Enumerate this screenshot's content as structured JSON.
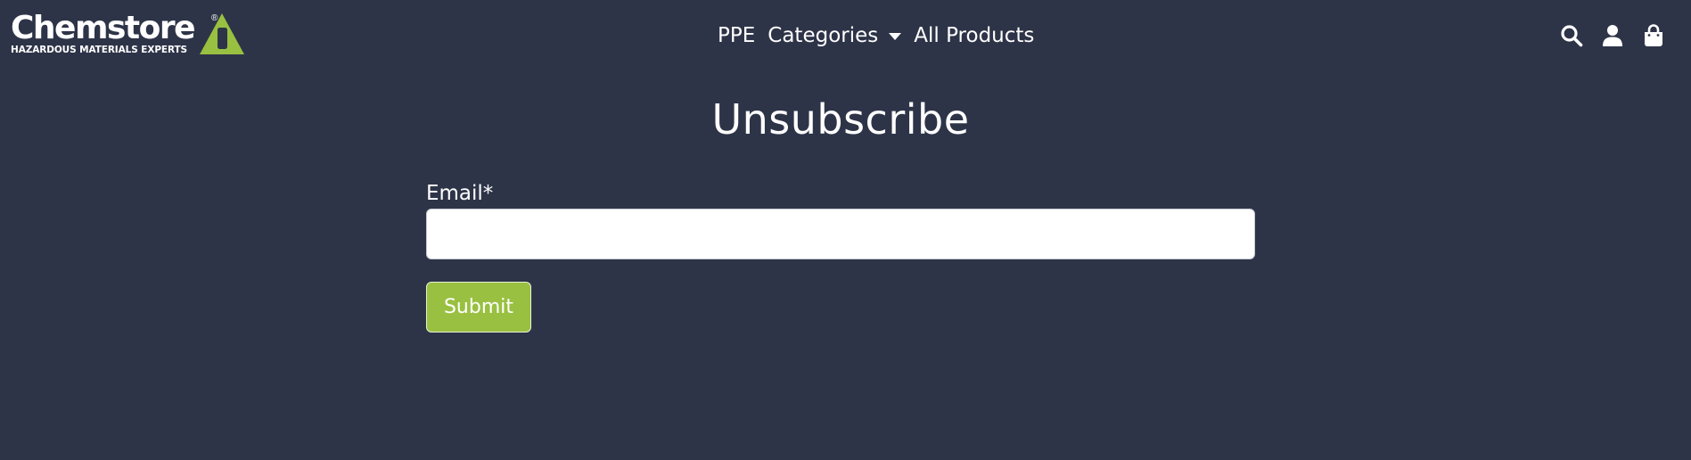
{
  "brand": {
    "name": "Chemstore",
    "registered_mark": "®",
    "tagline": "HAZARDOUS MATERIALS EXPERTS",
    "accent_color": "#99c040",
    "background_color": "#2e3448"
  },
  "nav": {
    "items": [
      {
        "label": "PPE"
      },
      {
        "label": "Categories",
        "has_dropdown": true
      },
      {
        "label": "All Products"
      }
    ]
  },
  "header_icons": [
    "search-icon",
    "account-icon",
    "cart-icon"
  ],
  "page": {
    "title": "Unsubscribe"
  },
  "form": {
    "email_label": "Email*",
    "email_value": "",
    "email_placeholder": "",
    "submit_label": "Submit"
  }
}
